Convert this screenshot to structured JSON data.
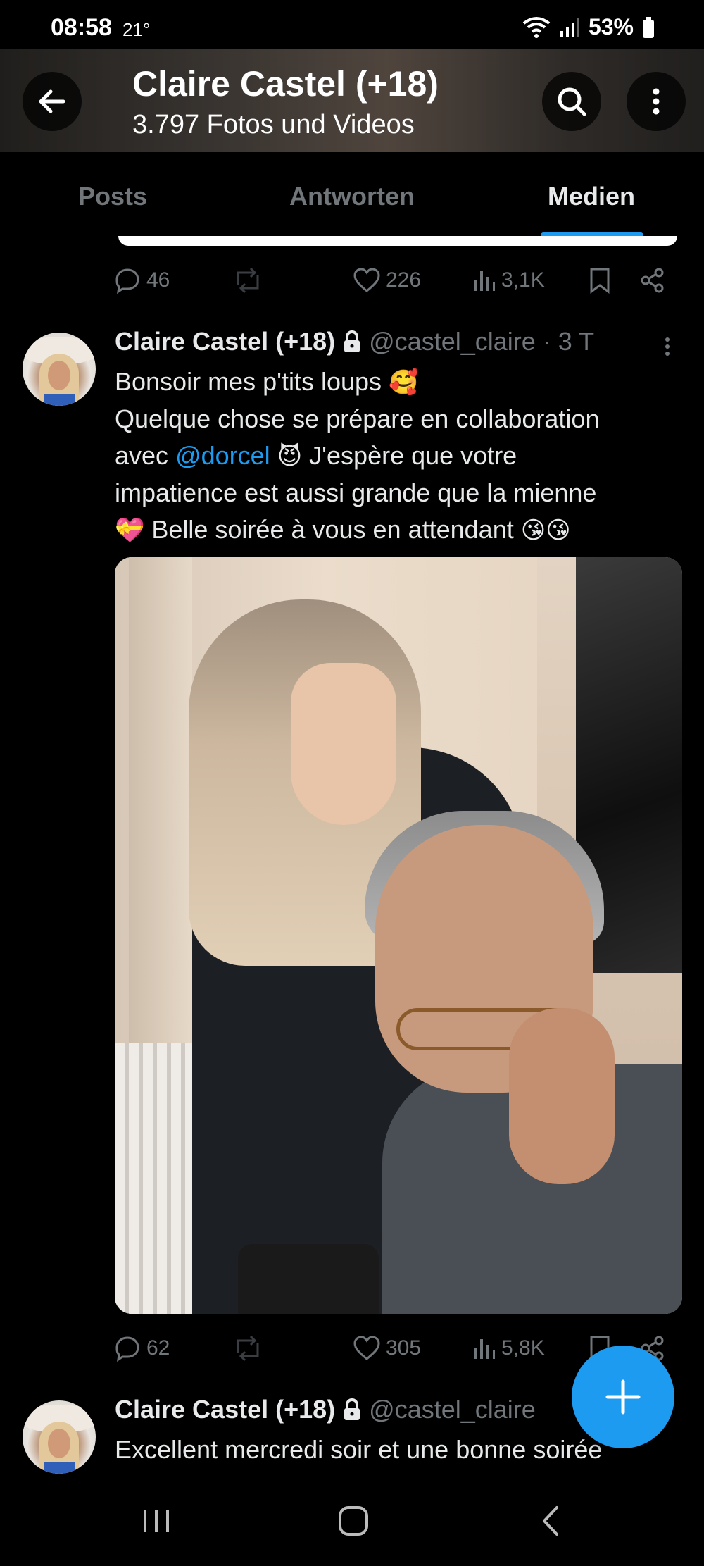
{
  "status_bar": {
    "time": "08:58",
    "temperature": "21°",
    "battery": "53%"
  },
  "header": {
    "title": "Claire Castel (+18)",
    "subtitle": "3.797 Fotos und Videos"
  },
  "tabs": [
    {
      "label": "Posts",
      "active": false
    },
    {
      "label": "Antworten",
      "active": false
    },
    {
      "label": "Medien",
      "active": true
    }
  ],
  "prev_post": {
    "replies": "46",
    "likes": "226",
    "views": "3,1K"
  },
  "post": {
    "author": "Claire Castel (+18)",
    "handle": "@castel_claire",
    "time": "· 3 T",
    "line1": "Bonsoir mes p'tits loups",
    "line1_emoji": "🥰",
    "line2": "Quelque chose se prépare en collaboration",
    "line3_pre": "avec",
    "mention": "@dorcel",
    "line3_emoji": "😈",
    "line3_post": "J'espère que votre",
    "line4": "impatience est aussi grande que la mienne",
    "line5_emoji": "💝",
    "line5": "Belle soirée à vous en attendant",
    "line5_end_emoji": "😘😘",
    "replies": "62",
    "likes": "305",
    "views": "5,8K"
  },
  "next_post": {
    "author": "Claire Castel (+18)",
    "handle": "@castel_claire",
    "text": "Excellent mercredi soir et une bonne soirée"
  },
  "colors": {
    "accent": "#1d9bf0",
    "muted": "#71767b",
    "text": "#e7e9ea",
    "divider": "#2f3336"
  },
  "icons": [
    "back-arrow-icon",
    "search-icon",
    "more-vertical-icon",
    "reply-icon",
    "repost-icon",
    "like-icon",
    "views-icon",
    "bookmark-icon",
    "share-icon",
    "lock-icon",
    "plus-icon"
  ]
}
